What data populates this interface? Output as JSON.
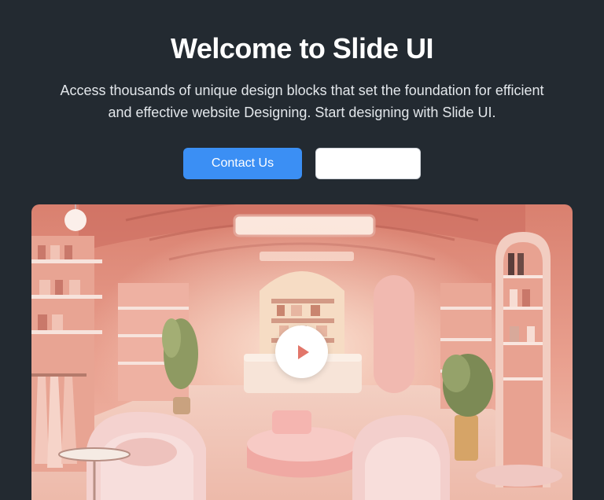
{
  "hero": {
    "title": "Welcome to Slide UI",
    "subtitle": "Access thousands of unique design blocks that set the foundation for efficient and effective website Designing. Start designing with Slide UI."
  },
  "actions": {
    "primary_label": "Contact Us",
    "secondary_label": ""
  },
  "media": {
    "play_icon": "play-icon"
  },
  "colors": {
    "background": "#232a31",
    "primary": "#3b8ff4",
    "scene_pink": "#e8978a"
  }
}
